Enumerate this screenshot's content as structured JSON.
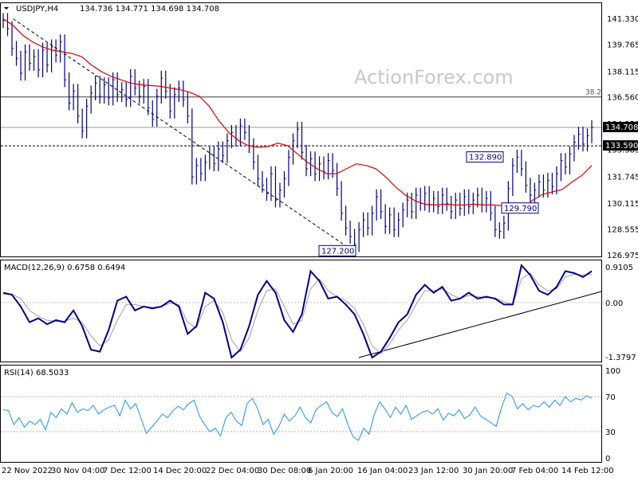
{
  "chart_data": [
    {
      "type": "line",
      "title": "USDJPY,H4",
      "ohlc_label": "134.736 134.771 134.698 134.708",
      "watermark": "ActionForex.com",
      "ylim": [
        126.975,
        141.33
      ],
      "y_ticks": [
        "141.330",
        "139.765",
        "138.115",
        "136.560",
        "134.950",
        "133.385",
        "131.745",
        "130.115",
        "128.555",
        "126.975"
      ],
      "x_ticks": [
        "22 Nov 2022",
        "30 Nov 04:00",
        "7 Dec 12:00",
        "14 Dec 20:00",
        "22 Dec 04:00",
        "30 Dec 08:00",
        "6 Jan 20:00",
        "16 Jan 04:00",
        "23 Jan 12:00",
        "30 Jan 20:00",
        "7 Feb 04:00",
        "14 Feb 12:00"
      ],
      "series": [
        {
          "type": "ohlc-bars",
          "color": "#000080",
          "values": [
            141.2,
            140.7,
            139.5,
            138.9,
            138.0,
            139.3,
            138.6,
            139.0,
            138.2,
            139.4,
            138.5,
            139.6,
            139.1,
            139.9,
            137.6,
            136.2,
            136.9,
            135.4,
            134.5,
            136.0,
            136.8,
            137.4,
            136.6,
            137.3,
            136.5,
            137.6,
            136.7,
            137.0,
            136.4,
            137.8,
            137.1,
            136.6,
            137.2,
            135.9,
            135.2,
            136.6,
            137.7,
            136.9,
            135.7,
            136.7,
            137.1,
            136.4,
            135.4,
            131.7,
            132.4,
            131.9,
            132.6,
            133.1,
            132.5,
            133.4,
            133.0,
            133.9,
            134.4,
            134.0,
            134.8,
            134.4,
            133.6,
            132.6,
            131.6,
            131.2,
            130.7,
            131.9,
            130.3,
            130.9,
            131.6,
            132.9,
            133.9,
            134.6,
            133.2,
            132.2,
            132.8,
            131.9,
            132.5,
            132.0,
            132.7,
            132.1,
            131.0,
            129.5,
            128.6,
            128.1,
            127.6,
            128.5,
            129.1,
            128.6,
            129.5,
            130.5,
            129.6,
            128.7,
            129.4,
            128.5,
            129.1,
            129.7,
            130.3,
            129.6,
            130.6,
            130.1,
            130.7,
            130.0,
            130.4,
            129.9,
            130.6,
            130.1,
            129.6,
            130.3,
            129.8,
            130.5,
            129.9,
            130.3,
            130.6,
            130.0,
            130.4,
            129.5,
            128.5,
            128.4,
            128.9,
            131.0,
            132.4,
            132.9,
            132.2,
            131.2,
            130.6,
            130.9,
            131.4,
            130.9,
            131.5,
            131.1,
            131.9,
            132.7,
            132.3,
            133.1,
            133.8,
            134.3,
            133.7,
            134.2,
            134.7
          ]
        },
        {
          "name": "",
          "type": "moving-average",
          "color": "#e00000",
          "values": [
            141.3,
            140.9,
            140.3,
            139.9,
            139.6,
            139.4,
            139.3,
            139.2,
            139.0,
            138.5,
            138.1,
            137.8,
            137.6,
            137.4,
            137.3,
            137.25,
            137.2,
            137.1,
            137.0,
            136.85,
            136.6,
            136.0,
            135.1,
            134.4,
            133.9,
            133.6,
            133.5,
            133.55,
            133.75,
            133.6,
            133.1,
            132.6,
            132.2,
            131.9,
            131.9,
            132.2,
            132.5,
            132.4,
            132.2,
            131.7,
            131.1,
            130.6,
            130.25,
            130.05,
            130.0,
            130.05,
            130.0,
            130.0,
            130.05,
            130.0,
            130.0,
            129.95,
            129.8,
            129.85,
            130.3,
            130.65,
            130.8,
            130.95,
            131.4,
            131.8,
            132.4
          ]
        }
      ],
      "hlines": [
        {
          "label": "38.2",
          "value": 136.56,
          "color": "#3a3a3a"
        },
        {
          "label": "134.708",
          "value": 134.708,
          "color": "#9a9a9a"
        }
      ],
      "support_line": {
        "value": 133.59,
        "style": "dashed",
        "label": "133.590"
      },
      "trend_line": {
        "from": [
          141.3
        ],
        "to": [
          127.2
        ],
        "style": "dashed"
      },
      "price_labels": [
        {
          "text": "132.890",
          "value": 132.89
        },
        {
          "text": "127.200",
          "value": 127.2
        },
        {
          "text": "129.790",
          "value": 129.79
        }
      ]
    },
    {
      "type": "line",
      "title": "MACD(12,26,9) 0.6758 0.6494",
      "ylim": [
        -1.3797,
        0.9105
      ],
      "y_ticks": [
        "0.9105",
        "0.00",
        "-1.3797"
      ],
      "zero_line": true,
      "series": [
        {
          "name": "",
          "color": "#00008b",
          "values": [
            0.25,
            0.2,
            -0.1,
            -0.5,
            -0.4,
            -0.55,
            -0.45,
            -0.5,
            -0.2,
            -0.6,
            -1.2,
            -1.25,
            -0.7,
            0.05,
            0.15,
            -0.2,
            -0.1,
            -0.15,
            -0.1,
            0.05,
            -0.1,
            -0.8,
            -0.6,
            0.25,
            0.1,
            -0.5,
            -1.4,
            -1.2,
            -0.6,
            0.2,
            0.55,
            0.25,
            -0.45,
            -0.75,
            -0.3,
            0.8,
            0.55,
            0.1,
            0.15,
            -0.05,
            -0.3,
            -0.8,
            -1.4,
            -1.25,
            -0.9,
            -0.5,
            -0.3,
            0.2,
            0.45,
            0.25,
            0.4,
            0.05,
            0.1,
            0.25,
            0.1,
            0.15,
            0.1,
            -0.05,
            -0.05,
            0.95,
            0.7,
            0.3,
            0.2,
            0.4,
            0.8,
            0.75,
            0.65,
            0.8
          ]
        },
        {
          "name": "",
          "color": "#a0a0a0",
          "values": [
            0.2,
            0.22,
            0.1,
            -0.2,
            -0.35,
            -0.45,
            -0.48,
            -0.47,
            -0.4,
            -0.5,
            -0.85,
            -1.1,
            -0.95,
            -0.45,
            -0.05,
            -0.05,
            -0.1,
            -0.12,
            -0.1,
            -0.02,
            -0.05,
            -0.5,
            -0.65,
            -0.1,
            0.05,
            -0.25,
            -0.95,
            -1.25,
            -0.9,
            -0.2,
            0.3,
            0.35,
            -0.1,
            -0.55,
            -0.45,
            0.35,
            0.6,
            0.3,
            0.15,
            0.05,
            -0.15,
            -0.55,
            -1.1,
            -1.3,
            -1.05,
            -0.7,
            -0.45,
            -0.05,
            0.3,
            0.3,
            0.35,
            0.2,
            0.1,
            0.18,
            0.15,
            0.12,
            0.12,
            0.02,
            -0.05,
            0.6,
            0.75,
            0.45,
            0.3,
            0.35,
            0.65,
            0.72,
            0.7,
            0.72
          ]
        }
      ],
      "trend_line": {
        "from": [
          -1.4
        ],
        "to": [
          0.28
        ],
        "style": "solid"
      }
    },
    {
      "type": "line",
      "title": "RSI(14) 68.5033",
      "ylim": [
        0,
        100
      ],
      "y_ticks": [
        "100",
        "70",
        "30",
        "0"
      ],
      "levels": [
        70,
        30
      ],
      "series": [
        {
          "name": "",
          "color": "#1e90ff",
          "values": [
            55,
            54,
            38,
            46,
            35,
            42,
            38,
            44,
            32,
            52,
            46,
            56,
            50,
            63,
            52,
            56,
            54,
            60,
            50,
            55,
            58,
            60,
            48,
            66,
            56,
            62,
            45,
            28,
            35,
            42,
            50,
            46,
            54,
            59,
            55,
            62,
            66,
            48,
            38,
            30,
            34,
            25,
            46,
            52,
            42,
            37,
            62,
            68,
            56,
            38,
            44,
            27,
            36,
            50,
            42,
            48,
            58,
            46,
            40,
            55,
            60,
            64,
            52,
            47,
            56,
            38,
            24,
            20,
            34,
            27,
            50,
            64,
            56,
            46,
            58,
            50,
            60,
            44,
            48,
            52,
            54,
            50,
            56,
            43,
            51,
            48,
            55,
            45,
            49,
            58,
            48,
            44,
            40,
            36,
            58,
            74,
            70,
            56,
            62,
            55,
            60,
            58,
            64,
            58,
            66,
            60,
            70,
            64,
            68,
            66,
            71,
            68
          ]
        }
      ]
    }
  ]
}
